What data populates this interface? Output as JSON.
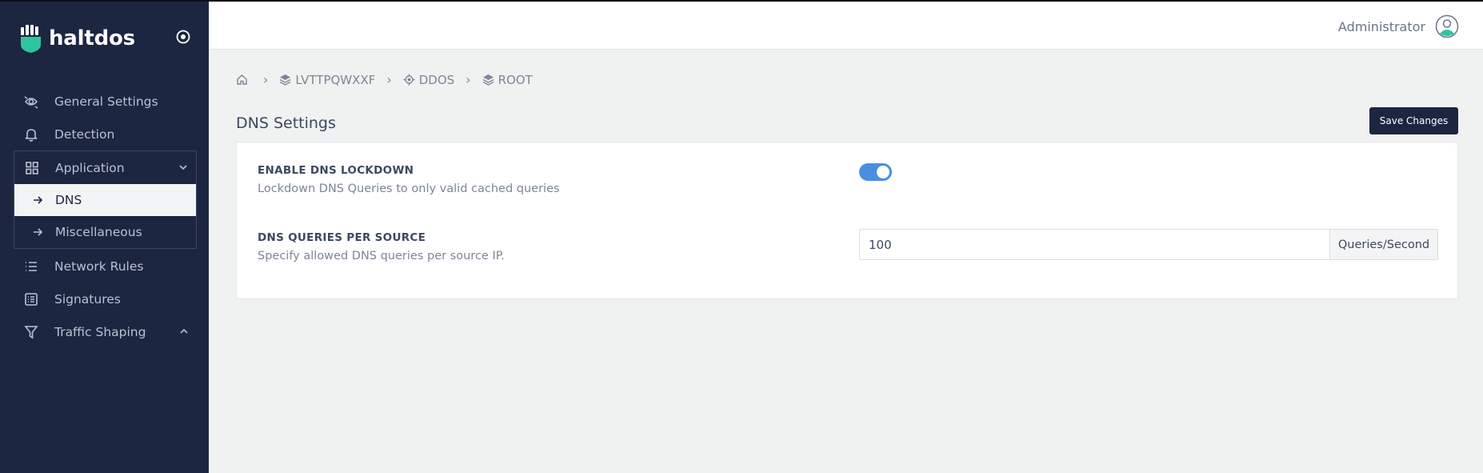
{
  "brand": {
    "name": "haltdos"
  },
  "sidebar": {
    "items": [
      {
        "label": "General Settings",
        "icon": "eye-gear-icon"
      },
      {
        "label": "Detection",
        "icon": "bell-icon"
      },
      {
        "label": "Application",
        "icon": "grid-icon",
        "expanded": true,
        "children": [
          {
            "label": "DNS",
            "active": true
          },
          {
            "label": "Miscellaneous",
            "active": false
          }
        ]
      },
      {
        "label": "Network Rules",
        "icon": "list-icon"
      },
      {
        "label": "Signatures",
        "icon": "document-list-icon"
      },
      {
        "label": "Traffic Shaping",
        "icon": "filter-icon",
        "expanded": false
      }
    ]
  },
  "topbar": {
    "user_name": "Administrator"
  },
  "breadcrumb": [
    {
      "label": "",
      "icon": "home-icon"
    },
    {
      "label": "LVTTPQWXXF",
      "icon": "layers-icon"
    },
    {
      "label": "DDOS",
      "icon": "crosshair-icon"
    },
    {
      "label": "ROOT",
      "icon": "layers-icon"
    }
  ],
  "page": {
    "title": "DNS Settings",
    "save_label": "Save Changes"
  },
  "settings": {
    "lockdown": {
      "title": "ENABLE DNS LOCKDOWN",
      "desc": "Lockdown DNS Queries to only valid cached queries",
      "enabled": true
    },
    "queries": {
      "title": "DNS QUERIES PER SOURCE",
      "desc": "Specify allowed DNS queries per source IP.",
      "value": "100",
      "unit": "Queries/Second"
    }
  },
  "colors": {
    "sidebar_bg": "#1c2640",
    "accent": "#4a8ee0",
    "logo_green": "#2fc4a0"
  }
}
